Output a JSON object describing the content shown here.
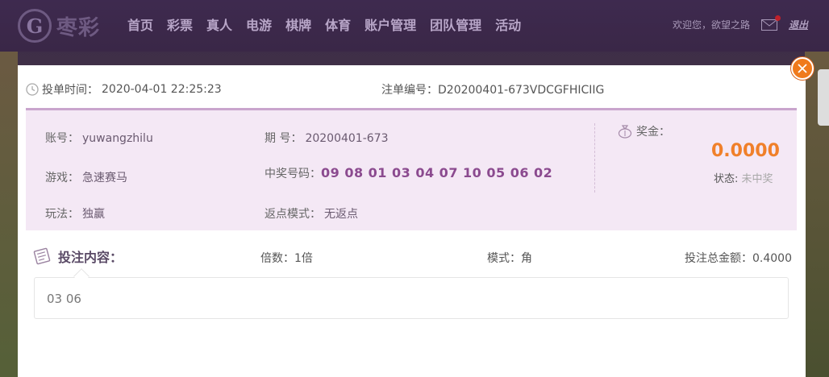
{
  "brand": {
    "logo_mark": "G",
    "logo_text": "枣彩"
  },
  "nav": {
    "items": [
      {
        "label": "首页"
      },
      {
        "label": "彩票"
      },
      {
        "label": "真人"
      },
      {
        "label": "电游"
      },
      {
        "label": "棋牌"
      },
      {
        "label": "体育"
      },
      {
        "label": "账户管理"
      },
      {
        "label": "团队管理"
      },
      {
        "label": "活动"
      }
    ]
  },
  "user": {
    "welcome": "欢迎您，欲望之路",
    "logout": "退出"
  },
  "modal": {
    "bet_time_label": "投单时间：",
    "bet_time": "2020-04-01 22:25:23",
    "order_label": "注单编号：",
    "order_id": "D20200401-673VDCGFHICIIG",
    "account_label": "账号：",
    "account": "yuwangzhilu",
    "period_label": "期 号：",
    "period": "20200401-673",
    "game_label": "游戏：",
    "game": "急速赛马",
    "win_label": "中奖号码：",
    "win_numbers": "09 08 01 03 04 07 10 05 06 02",
    "play_label": "玩法：",
    "play": "独赢",
    "rebate_label": "返点模式：",
    "rebate": "无返点",
    "bonus_label": "奖金：",
    "bonus": "0.0000",
    "status_label": "状态:",
    "status": "未中奖",
    "bet_content_label": "投注内容：",
    "multiplier": "倍数：1倍",
    "mode": "模式：角",
    "total": "投注总金额：0.4000",
    "bet_numbers": "03 06"
  },
  "colors": {
    "accent_orange": "#f07a1c",
    "ticket_bg": "#f4e8f5",
    "win_number": "#8b4a8f",
    "nav_bg": "#3e2a4f"
  }
}
